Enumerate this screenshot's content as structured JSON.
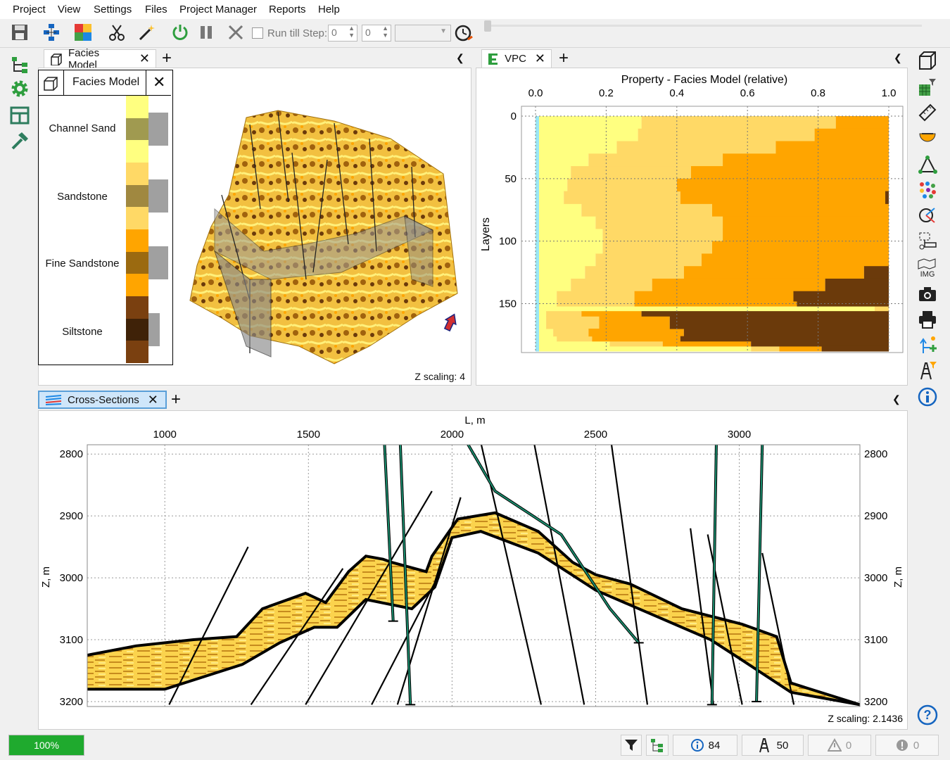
{
  "menu": {
    "items": [
      "Project",
      "View",
      "Settings",
      "Files",
      "Project Manager",
      "Reports",
      "Help"
    ]
  },
  "toolbar": {
    "run_till_step_label": "Run till Step:",
    "step_value_1": "0",
    "step_value_2": "0",
    "icons": [
      "save-icon",
      "hierarchy-icon",
      "puzzle-icon",
      "scissors-icon",
      "magic-wand-icon",
      "power-icon",
      "pause-icon",
      "cancel-icon",
      "timer-icon"
    ]
  },
  "facies_panel": {
    "tab_label": "Facies Model",
    "legend_title": "Facies Model",
    "legend": [
      {
        "name": "Channel Sand",
        "colors": [
          "#ffff80",
          "#a09a50",
          "#ffff80"
        ]
      },
      {
        "name": "Sandstone",
        "colors": [
          "#ffd966",
          "#a08840",
          "#ffd966"
        ]
      },
      {
        "name": "Fine Sandstone",
        "colors": [
          "#ffa500",
          "#9b6a10",
          "#ffa500"
        ]
      },
      {
        "name": "Siltstone",
        "colors": [
          "#7a4010",
          "#3f2208",
          "#7a4010"
        ]
      }
    ],
    "z_scaling": "Z scaling: 4"
  },
  "vpc_panel": {
    "tab_label": "VPC",
    "chart_data": {
      "type": "area",
      "title": "Property - Facies Model (relative)",
      "ylabel": "Layers",
      "xlabel": "",
      "xlim": [
        0,
        1
      ],
      "ylim": [
        0,
        188
      ],
      "y_inverted": true,
      "x_ticks": [
        "0.0",
        "0.2",
        "0.4",
        "0.6",
        "0.8",
        "1.0"
      ],
      "y_ticks": [
        "0",
        "50",
        "100",
        "150"
      ],
      "layers": [
        0,
        10,
        20,
        30,
        40,
        50,
        60,
        70,
        80,
        90,
        100,
        110,
        120,
        130,
        140,
        148,
        152,
        156,
        160,
        170,
        176,
        180,
        184,
        188
      ],
      "series": [
        {
          "color": "#9be7f5",
          "values": [
            0.01,
            0.01,
            0.01,
            0.01,
            0.01,
            0.01,
            0.01,
            0.01,
            0.01,
            0.01,
            0.01,
            0.01,
            0.01,
            0.01,
            0.01,
            0.01,
            0.01,
            0.01,
            0.01,
            0.01,
            0.01,
            0.01,
            0.01,
            0.01
          ]
        },
        {
          "color": "#ffff80",
          "values": [
            0.29,
            0.28,
            0.22,
            0.14,
            0.09,
            0.08,
            0.07,
            0.12,
            0.16,
            0.18,
            0.18,
            0.16,
            0.13,
            0.09,
            0.05,
            0.05,
            0.95,
            0.02,
            0.02,
            0.04,
            0.05,
            0.2,
            0.6,
            0.01
          ]
        },
        {
          "color": "#ffd966",
          "values": [
            0.55,
            0.5,
            0.45,
            0.38,
            0.34,
            0.31,
            0.33,
            0.37,
            0.36,
            0.34,
            0.31,
            0.3,
            0.28,
            0.23,
            0.22,
            0.22,
            0.05,
            0.1,
            0.15,
            0.1,
            0.1,
            0.15,
            0.08,
            0.01
          ]
        },
        {
          "color": "#ffa500",
          "values": [
            0.97,
            0.82,
            0.72,
            0.68,
            0.66,
            0.64,
            0.58,
            0.54,
            0.55,
            0.58,
            0.58,
            0.55,
            0.51,
            0.49,
            0.45,
            0.46,
            0.0,
            0.17,
            0.2,
            0.27,
            0.25,
            0.25,
            0.12,
            0.02
          ]
        },
        {
          "color": "#6b3a0b",
          "values": [
            0.0,
            0.18,
            0.17,
            0.16,
            0.16,
            0.17,
            0.21,
            0.25,
            0.23,
            0.24,
            0.24,
            0.28,
            0.32,
            0.37,
            0.42,
            0.41,
            0.0,
            0.7,
            0.62,
            0.58,
            0.59,
            0.39,
            0.19,
            0.95
          ]
        }
      ]
    }
  },
  "cross_section_panel": {
    "tab_label": "Cross-Sections",
    "chart_data": {
      "type": "line",
      "title": "",
      "xlabel": "L, m",
      "ylabel": "Z, m",
      "xlim": [
        730,
        3420
      ],
      "ylim": [
        2785,
        3208
      ],
      "y_inverted": true,
      "x_ticks": [
        1000,
        1500,
        2000,
        2500,
        3000
      ],
      "y_ticks": [
        2800,
        2900,
        3000,
        3100,
        3200
      ],
      "grid": true,
      "fault_lines": [
        [
          [
            1015,
            3205
          ],
          [
            1290,
            2950
          ]
        ],
        [
          [
            1300,
            3205
          ],
          [
            1620,
            2985
          ]
        ],
        [
          [
            1490,
            3205
          ],
          [
            1930,
            2860
          ]
        ],
        [
          [
            1720,
            3205
          ],
          [
            1960,
            2990
          ]
        ],
        [
          [
            1810,
            3205
          ],
          [
            2030,
            2870
          ]
        ],
        [
          [
            2310,
            3205
          ],
          [
            2040,
            2660
          ]
        ],
        [
          [
            2460,
            3205
          ],
          [
            2260,
            2720
          ]
        ],
        [
          [
            2680,
            3205
          ],
          [
            2530,
            2700
          ]
        ],
        [
          [
            2910,
            3205
          ],
          [
            2830,
            2920
          ]
        ],
        [
          [
            3010,
            3205
          ],
          [
            2890,
            2930
          ]
        ],
        [
          [
            3190,
            3205
          ],
          [
            3080,
            2960
          ]
        ]
      ],
      "wells": [
        [
          [
            1765,
            2785
          ],
          [
            1795,
            3070
          ]
        ],
        [
          [
            1820,
            2785
          ],
          [
            1855,
            3205
          ]
        ],
        [
          [
            1950,
            2700
          ],
          [
            2150,
            2860
          ],
          [
            2380,
            2930
          ],
          [
            2550,
            3050
          ],
          [
            2650,
            3105
          ]
        ],
        [
          [
            2920,
            2785
          ],
          [
            2905,
            3205
          ]
        ],
        [
          [
            3080,
            2785
          ],
          [
            3060,
            3200
          ]
        ]
      ],
      "layer_top": [
        [
          730,
          3125
        ],
        [
          900,
          3110
        ],
        [
          1100,
          3100
        ],
        [
          1250,
          3095
        ],
        [
          1340,
          3050
        ],
        [
          1490,
          3025
        ],
        [
          1560,
          3040
        ],
        [
          1640,
          2990
        ],
        [
          1700,
          2965
        ],
        [
          1760,
          2970
        ],
        [
          1790,
          2975
        ],
        [
          1910,
          2990
        ],
        [
          1930,
          2965
        ],
        [
          2020,
          2905
        ],
        [
          2150,
          2895
        ],
        [
          2300,
          2925
        ],
        [
          2420,
          2975
        ],
        [
          2500,
          2995
        ],
        [
          2620,
          3010
        ],
        [
          2800,
          3050
        ],
        [
          3010,
          3075
        ],
        [
          3130,
          3095
        ],
        [
          3180,
          3170
        ],
        [
          3420,
          3205
        ]
      ],
      "layer_bottom": [
        [
          730,
          3180
        ],
        [
          1000,
          3180
        ],
        [
          1270,
          3140
        ],
        [
          1400,
          3105
        ],
        [
          1520,
          3080
        ],
        [
          1600,
          3080
        ],
        [
          1700,
          3035
        ],
        [
          1860,
          3050
        ],
        [
          1940,
          3015
        ],
        [
          2000,
          2935
        ],
        [
          2100,
          2925
        ],
        [
          2300,
          2960
        ],
        [
          2500,
          3020
        ],
        [
          2700,
          3060
        ],
        [
          2900,
          3100
        ],
        [
          3000,
          3130
        ],
        [
          3180,
          3185
        ],
        [
          3420,
          3205
        ]
      ]
    },
    "z_scaling": "Z scaling: 2.1436"
  },
  "status": {
    "progress_label": "100%",
    "progress": 1.0,
    "info_count": "84",
    "wells_count": "50",
    "warning_count": "0",
    "error_count": "0"
  }
}
